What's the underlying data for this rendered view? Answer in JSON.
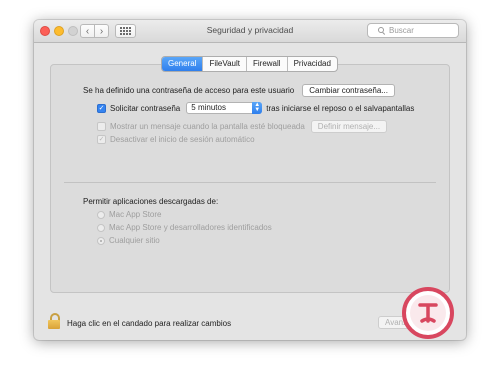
{
  "window": {
    "title": "Seguridad y privacidad",
    "search_placeholder": "Buscar"
  },
  "tabs": [
    {
      "label": "General",
      "active": true
    },
    {
      "label": "FileVault",
      "active": false
    },
    {
      "label": "Firewall",
      "active": false
    },
    {
      "label": "Privacidad",
      "active": false
    }
  ],
  "general": {
    "password_text": "Se ha definido una contraseña de acceso para este usuario",
    "change_password_button": "Cambiar contraseña...",
    "require_password": {
      "label": "Solicitar contraseña",
      "checked": true,
      "interval": "5 minutos",
      "suffix": "tras iniciarse el reposo o el salvapantallas"
    },
    "show_message": {
      "label": "Mostrar un mensaje cuando la pantalla esté bloqueada",
      "checked": false,
      "button": "Definir mensaje..."
    },
    "disable_auto_login": {
      "label": "Desactivar el inicio de sesión automático",
      "checked": true
    }
  },
  "downloads": {
    "heading": "Permitir aplicaciones descargadas de:",
    "options": [
      {
        "label": "Mac App Store",
        "selected": false
      },
      {
        "label": "Mac App Store y desarrolladores identificados",
        "selected": false
      },
      {
        "label": "Cualquier sitio",
        "selected": true
      }
    ]
  },
  "footer": {
    "lock_text": "Haga clic en el candado para realizar cambios",
    "advanced_button": "Avanzado..."
  },
  "colors": {
    "accent": "#3584f1",
    "lock": "#d9a237",
    "watermark": "#d8475f"
  }
}
